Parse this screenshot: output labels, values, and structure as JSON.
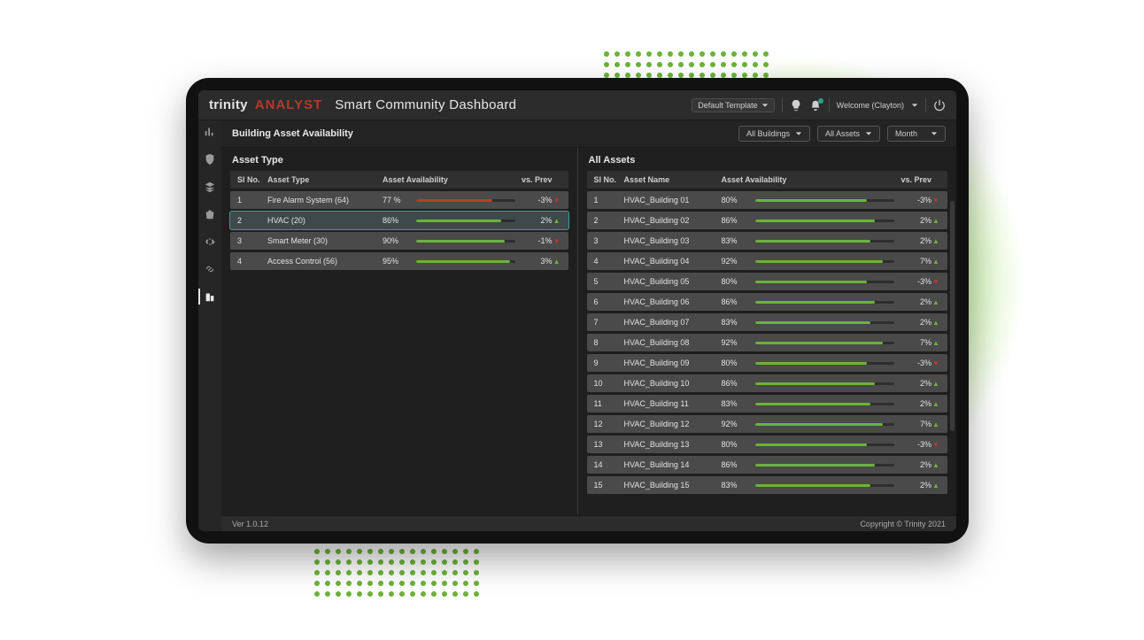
{
  "brand": {
    "prefix": "trinity",
    "suffix": "ANALYST",
    "title": "Smart Community Dashboard"
  },
  "topbar": {
    "template_label": "Default Template",
    "welcome": "Welcome (Clayton)"
  },
  "page": {
    "title": "Building Asset Availability"
  },
  "filters": {
    "buildings": "All Buildings",
    "assets": "All Assets",
    "range": "Month"
  },
  "left_panel": {
    "title": "Asset Type",
    "columns": {
      "sl": "Sl No.",
      "name": "Asset Type",
      "avail": "Asset Availability",
      "prev": "vs. Prev"
    },
    "rows": [
      {
        "sl": "1",
        "name": "Fire Alarm System (64)",
        "avail_label": "77 %",
        "avail_pct": 77,
        "bar": "red",
        "prev": "-3%",
        "dir": "down",
        "selected": false
      },
      {
        "sl": "2",
        "name": "HVAC (20)",
        "avail_label": "86%",
        "avail_pct": 86,
        "bar": "green",
        "prev": "2%",
        "dir": "up",
        "selected": true
      },
      {
        "sl": "3",
        "name": "Smart Meter (30)",
        "avail_label": "90%",
        "avail_pct": 90,
        "bar": "green",
        "prev": "-1%",
        "dir": "down",
        "selected": false
      },
      {
        "sl": "4",
        "name": "Access Control (56)",
        "avail_label": "95%",
        "avail_pct": 95,
        "bar": "green",
        "prev": "3%",
        "dir": "up",
        "selected": false
      }
    ]
  },
  "right_panel": {
    "title": "All Assets",
    "columns": {
      "sl": "Sl No.",
      "name": "Asset Name",
      "avail": "Asset Availability",
      "prev": "vs. Prev"
    },
    "rows": [
      {
        "sl": "1",
        "name": "HVAC_Building 01",
        "avail_label": "80%",
        "avail_pct": 80,
        "bar": "green",
        "prev": "-3%",
        "dir": "down"
      },
      {
        "sl": "2",
        "name": "HVAC_Building 02",
        "avail_label": "86%",
        "avail_pct": 86,
        "bar": "green",
        "prev": "2%",
        "dir": "up"
      },
      {
        "sl": "3",
        "name": "HVAC_Building 03",
        "avail_label": "83%",
        "avail_pct": 83,
        "bar": "green",
        "prev": "2%",
        "dir": "up"
      },
      {
        "sl": "4",
        "name": "HVAC_Building 04",
        "avail_label": "92%",
        "avail_pct": 92,
        "bar": "green",
        "prev": "7%",
        "dir": "up"
      },
      {
        "sl": "5",
        "name": "HVAC_Building 05",
        "avail_label": "80%",
        "avail_pct": 80,
        "bar": "green",
        "prev": "-3%",
        "dir": "down"
      },
      {
        "sl": "6",
        "name": "HVAC_Building 06",
        "avail_label": "86%",
        "avail_pct": 86,
        "bar": "green",
        "prev": "2%",
        "dir": "up"
      },
      {
        "sl": "7",
        "name": "HVAC_Building 07",
        "avail_label": "83%",
        "avail_pct": 83,
        "bar": "green",
        "prev": "2%",
        "dir": "up"
      },
      {
        "sl": "8",
        "name": "HVAC_Building 08",
        "avail_label": "92%",
        "avail_pct": 92,
        "bar": "green",
        "prev": "7%",
        "dir": "up"
      },
      {
        "sl": "9",
        "name": "HVAC_Building 09",
        "avail_label": "80%",
        "avail_pct": 80,
        "bar": "green",
        "prev": "-3%",
        "dir": "down"
      },
      {
        "sl": "10",
        "name": "HVAC_Building 10",
        "avail_label": "86%",
        "avail_pct": 86,
        "bar": "green",
        "prev": "2%",
        "dir": "up"
      },
      {
        "sl": "11",
        "name": "HVAC_Building 11",
        "avail_label": "83%",
        "avail_pct": 83,
        "bar": "green",
        "prev": "2%",
        "dir": "up"
      },
      {
        "sl": "12",
        "name": "HVAC_Building 12",
        "avail_label": "92%",
        "avail_pct": 92,
        "bar": "green",
        "prev": "7%",
        "dir": "up"
      },
      {
        "sl": "13",
        "name": "HVAC_Building 13",
        "avail_label": "80%",
        "avail_pct": 80,
        "bar": "green",
        "prev": "-3%",
        "dir": "down"
      },
      {
        "sl": "14",
        "name": "HVAC_Building 14",
        "avail_label": "86%",
        "avail_pct": 86,
        "bar": "green",
        "prev": "2%",
        "dir": "up"
      },
      {
        "sl": "15",
        "name": "HVAC_Building 15",
        "avail_label": "83%",
        "avail_pct": 83,
        "bar": "green",
        "prev": "2%",
        "dir": "up"
      }
    ]
  },
  "footer": {
    "version": "Ver 1.0.12",
    "copyright": "Copyright © Trinity 2021"
  }
}
